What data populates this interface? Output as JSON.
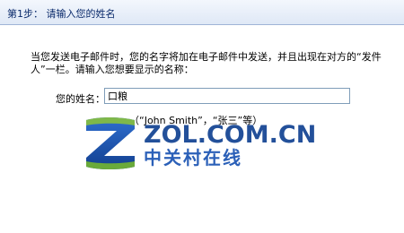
{
  "header": {
    "title": "第1步： 请输入您的姓名"
  },
  "instructions": "当您发送电子邮件时，您的名字将加在电子邮件中发送，并且出现在对方的“发件人”一栏。请输入您想要显示的名称：",
  "name_field": {
    "label": "您的姓名：",
    "value": "口粮"
  },
  "example": "（“John Smith”，“张三”等）",
  "watermark": {
    "brand": "ZOL.COM.CN",
    "subtitle": "中关村在线"
  }
}
